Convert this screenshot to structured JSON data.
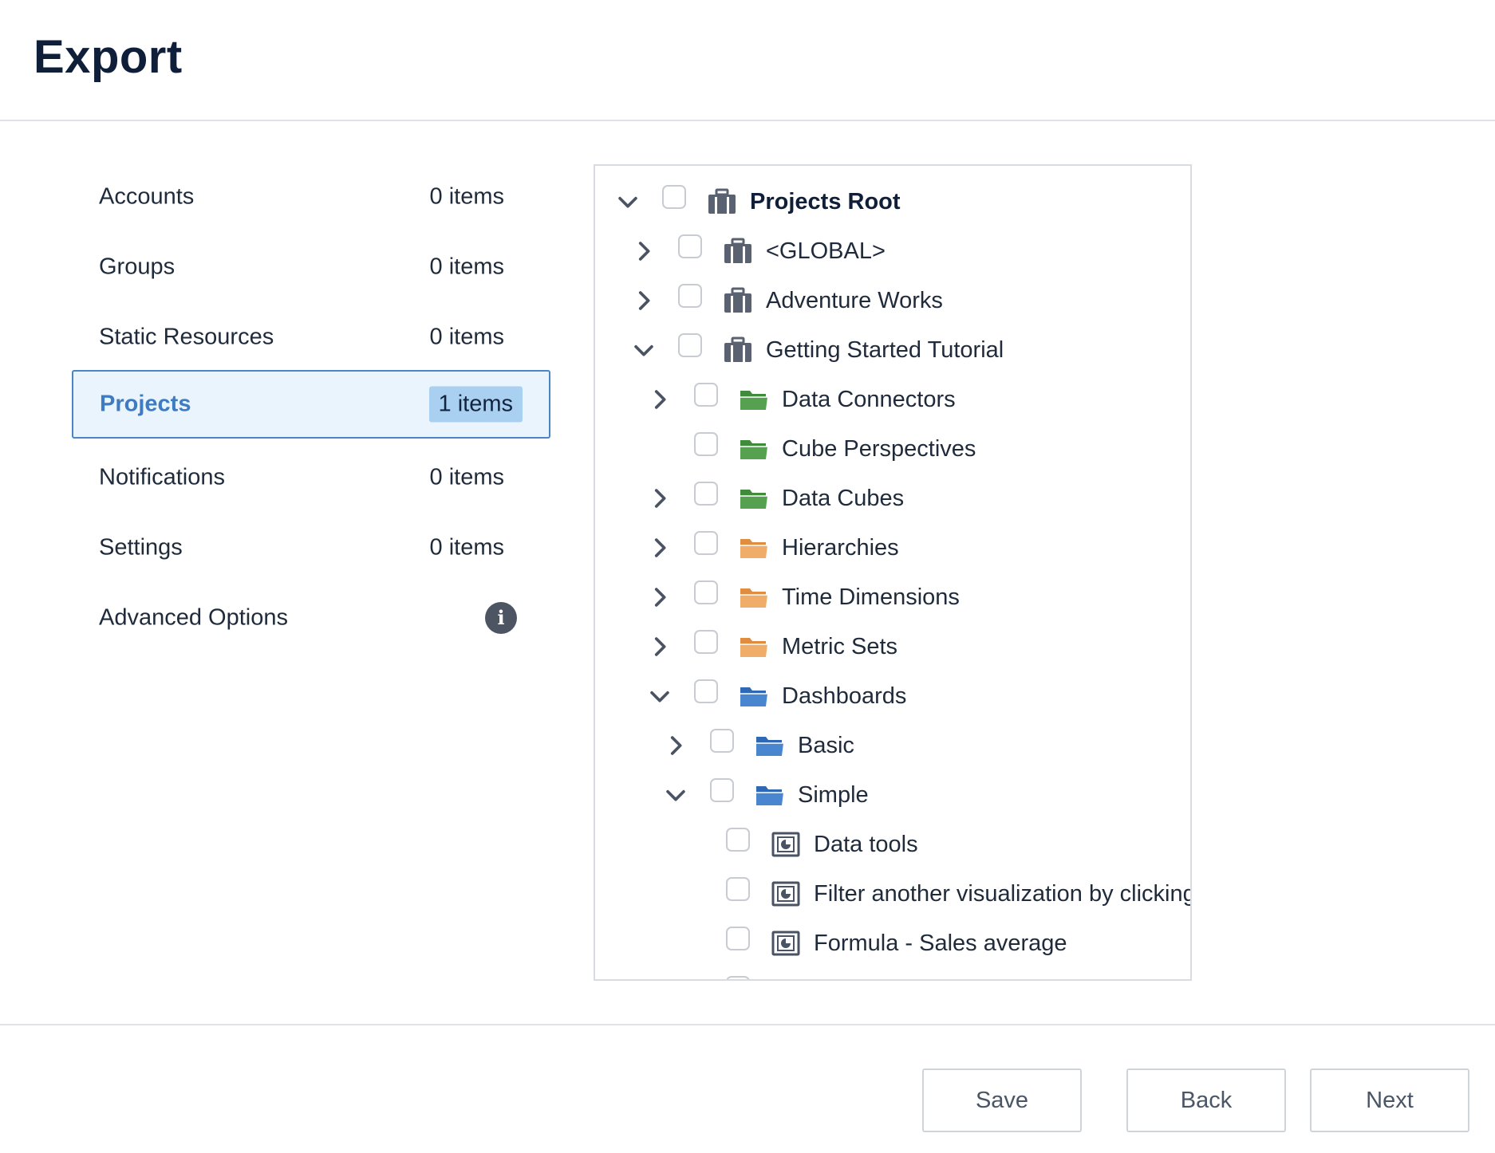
{
  "page": {
    "title": "Export"
  },
  "nav": {
    "accounts": {
      "label": "Accounts",
      "count": "0 items"
    },
    "groups": {
      "label": "Groups",
      "count": "0 items"
    },
    "static_resources": {
      "label": "Static Resources",
      "count": "0 items"
    },
    "projects": {
      "label": "Projects",
      "count": "1 items"
    },
    "notifications": {
      "label": "Notifications",
      "count": "0 items"
    },
    "settings": {
      "label": "Settings",
      "count": "0 items"
    },
    "advanced_options": {
      "label": "Advanced Options",
      "icon": "info-icon"
    }
  },
  "tree": {
    "projects_root": "Projects Root",
    "global": "<GLOBAL>",
    "adventure_works": "Adventure Works",
    "getting_started": "Getting Started Tutorial",
    "data_connectors": "Data Connectors",
    "cube_perspectives": "Cube Perspectives",
    "data_cubes": "Data Cubes",
    "hierarchies": "Hierarchies",
    "time_dimensions": "Time Dimensions",
    "metric_sets": "Metric Sets",
    "dashboards": "Dashboards",
    "basic": "Basic",
    "simple": "Simple",
    "data_tools": "Data tools",
    "filter_viz": "Filter another visualization by clicking",
    "formula_sales": "Formula - Sales average"
  },
  "footer": {
    "save_label": "Save",
    "back_label": "Back",
    "next_label": "Next"
  },
  "colors": {
    "project_icon": "#5a6272",
    "folder_green": "#3f8a3b",
    "folder_orange": "#e8a15a",
    "folder_blue": "#3c78c8",
    "active_border": "#4a85c4",
    "active_bg": "#eaf4fc",
    "active_badge": "#a9d0f0"
  }
}
